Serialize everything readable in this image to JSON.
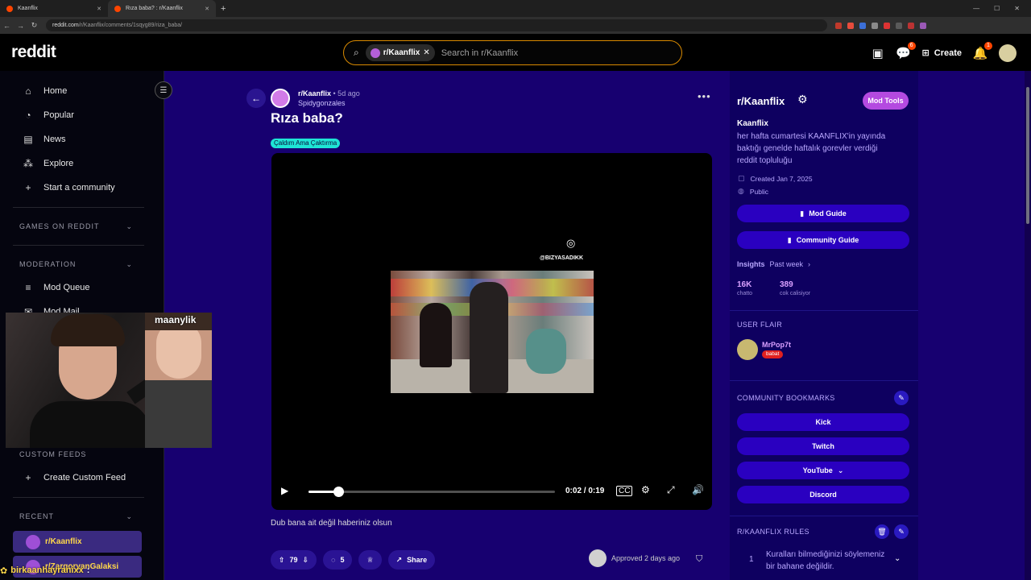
{
  "browser": {
    "tabs": [
      {
        "label": "Kaanflix",
        "active": false
      },
      {
        "label": "Rıza baba? : r/Kaanflix",
        "active": true
      }
    ],
    "url_domain": "reddit.com",
    "url_path": "/r/Kaanflix/comments/1sqyg89/riza_baba/"
  },
  "header": {
    "logo": "reddit",
    "search_chip": "r/Kaanflix",
    "search_placeholder": "Search in r/Kaanflix",
    "chat_badge": "6",
    "create_label": "Create",
    "notif_badge": "1"
  },
  "sidebar": {
    "items": [
      {
        "icon": "home-icon",
        "label": "Home"
      },
      {
        "icon": "popular-icon",
        "label": "Popular"
      },
      {
        "icon": "news-icon",
        "label": "News"
      },
      {
        "icon": "explore-icon",
        "label": "Explore"
      },
      {
        "icon": "plus-icon",
        "label": "Start a community"
      }
    ],
    "games_heading": "GAMES ON REDDIT",
    "moderation_heading": "MODERATION",
    "mod_queue": "Mod Queue",
    "mod_mail": "Mod Mail",
    "custom_feeds_heading": "CUSTOM FEEDS",
    "create_feed": "Create Custom Feed",
    "recent_heading": "RECENT",
    "recent": [
      "r/Kaanflix",
      "r/ZargoryanGalaksi"
    ]
  },
  "post": {
    "subreddit": "r/Kaanflix",
    "time": "• 5d ago",
    "author": "Spidygonzales",
    "title": "Rıza baba?",
    "flair": "Çaldım Ama Çaktırma",
    "video_handle": "@BIZYASADIKK",
    "video_time": "0:02 / 0:19",
    "video_progress": 0.12,
    "body": "Dub bana ait değil haberiniz olsun",
    "votes": "79",
    "comments": "5",
    "share_label": "Share",
    "approved": "Approved 2 days ago"
  },
  "rail": {
    "title": "r/Kaanflix",
    "mod_tools": "Mod Tools",
    "name": "Kaanflix",
    "description": "her hafta cumartesi KAANFLIX'in yayında baktığı genelde haftalık gorevler verdiği reddit topluluğu",
    "created": "Created Jan 7, 2025",
    "visibility": "Public",
    "mod_guide": "Mod Guide",
    "community_guide": "Community Guide",
    "insights": "Insights",
    "insights_period": "Past week",
    "stat1_value": "16K",
    "stat1_label": "chatto",
    "stat2_value": "389",
    "stat2_label": "cok calisiyor",
    "user_flair_heading": "USER FLAIR",
    "user_flair_name": "MrPop7t",
    "user_flair_tag": "babat",
    "bookmarks_heading": "COMMUNITY BOOKMARKS",
    "bookmarks": [
      "Kick",
      "Twitch",
      "YouTube",
      "Discord"
    ],
    "rules_heading": "R/KAANFLIX RULES",
    "rule1_num": "1",
    "rule1_text": "Kuralları bilmediğinizi söylemeniz bir bahane değildir."
  },
  "stream": {
    "inset_tag": "maanylik",
    "chat_user": "birkaanhayranixx",
    "chat_msg": ":"
  }
}
